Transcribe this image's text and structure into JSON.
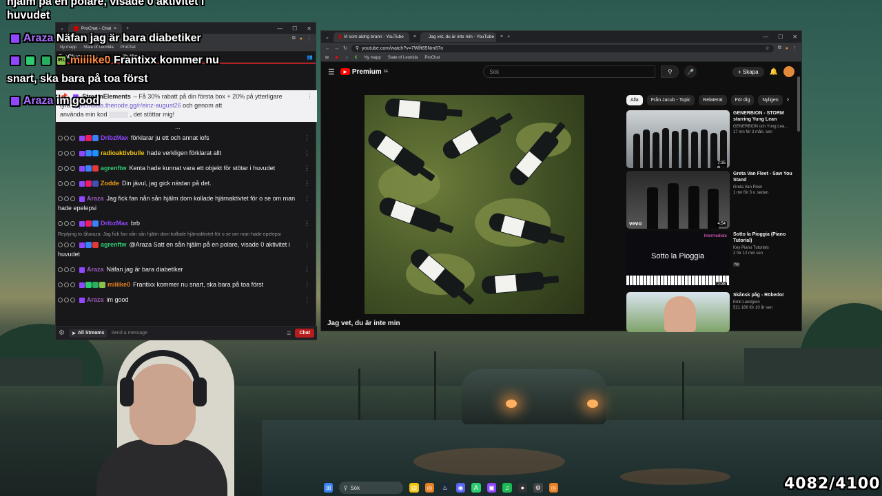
{
  "overlay": {
    "top_line": "hjälm på en polare, visade 0 aktivitet i",
    "top_line2": "huvudet",
    "line1_user": "Araza",
    "line1_text": "Näfan jag är bara diabetiker",
    "line2_user": "miiiike0",
    "line2_text": "Frantixx kommer nu",
    "line2_cont": "snart, ska bara på toa först",
    "line3_user": "Araza",
    "line3_text": "im good",
    "badge_irl": "IRL"
  },
  "chat_window": {
    "tab_title": "ProChat - Chat",
    "bookmarks": [
      "Ny mapp",
      "State of Leonida",
      "ProChat"
    ],
    "header_title": "ProChat",
    "header_badge": "FREE",
    "uptime": "3h 45m",
    "pinned": {
      "author": "StreamElements",
      "text1": "– Få 30% rabatt på din första box + 20% på ytterligare",
      "text2_prefix": "tyra",
      "link": "https://tools.thenode.gg/r/einz-august26",
      "text2_suffix": "och genom att",
      "text3_prefix": "använda min kod",
      "text3_suffix": ", det stöttar mig!"
    },
    "partial_top": "...",
    "messages": [
      {
        "user": "DribzMax",
        "color": "#9146ff",
        "text": "förklarar ju ett och annat iofs",
        "badges": [
          "#9146ff",
          "#e91e63",
          "#3a82f7"
        ]
      },
      {
        "user": "radioaktivbulle",
        "color": "#f1c40f",
        "text": "hade verkligen förklarat allt",
        "badges": [
          "#9146ff",
          "#3a82f7",
          "#1e90ff"
        ]
      },
      {
        "user": "agrenftw",
        "color": "#2ecc71",
        "text": "Kenta hade kunnat vara ett objekt för stötar i huvudet",
        "badges": [
          "#9146ff",
          "#3a82f7",
          "#e53935"
        ]
      },
      {
        "user": "Zodde",
        "color": "#f39c12",
        "text": "Din jävul, jag gick nästan på det.",
        "badges": [
          "#9146ff",
          "#e91e63",
          "#3f51b5"
        ]
      },
      {
        "user": "Araza",
        "color": "#9b59b6",
        "text": "Jag fick fan nån sån hjälm dom kollade hjärnaktivtet för o se om man hade epelepsi",
        "badges": [
          "#9146ff"
        ]
      },
      {
        "user": "DribzMax",
        "color": "#9146ff",
        "text": "brb",
        "badges": [
          "#9146ff",
          "#e91e63",
          "#3a82f7"
        ]
      },
      {
        "reply": "Replying to @araza: Jag fick fan nån sån hjälm dom kollade hjärnaktivtet för o se om man hade epelepsi",
        "user": "agrenftw",
        "color": "#2ecc71",
        "text": "@Araza Satt en sån hjälm på en polare, visade 0 aktivitet i huvudet",
        "badges": [
          "#9146ff",
          "#3a82f7",
          "#e53935"
        ]
      },
      {
        "user": "Araza",
        "color": "#9b59b6",
        "text": "Näfan jag är bara diabetiker",
        "badges": [
          "#9146ff"
        ]
      },
      {
        "user": "miiiike0",
        "color": "#e67e22",
        "text": "Frantixx kommer nu snart, ska bara på toa först",
        "badges": [
          "#9146ff",
          "#2ecc71",
          "#27ae60",
          "#8bc34a"
        ]
      },
      {
        "user": "Araza",
        "color": "#9b59b6",
        "text": "im good",
        "badges": [
          "#9146ff"
        ]
      }
    ],
    "input": {
      "streams_label": "All Streams",
      "placeholder": "Send a message",
      "chat_button": "Chat"
    }
  },
  "youtube_window": {
    "tabs": [
      "Vi som aldrig brann - YouTube",
      "Jag vet, du är inte min - YouTube"
    ],
    "url": "youtube.com/watch?v=7Wlft65Nm87o",
    "bookmarks": [
      "Ny mapp",
      "State of Leonida",
      "ProChat"
    ],
    "logo_text": "Premium",
    "logo_sup": "SE",
    "search_placeholder": "Sök",
    "create_label": "Skapa",
    "video_title": "Jag vet, du är inte min",
    "chips": [
      "Alla",
      "Från Jacub - Topic",
      "Relaterat",
      "För dig",
      "Nyligen"
    ],
    "recommendations": [
      {
        "title": "GENERBION - STORM starring Yung Lean",
        "channel": "GENERBION och Yung Lea...",
        "meta": "17 mn för 3 mån. sen",
        "duration": "7:35"
      },
      {
        "title": "Greta Van Fleet - Saw You Stand",
        "channel": "Greta Van Fleet",
        "meta": "1 mn för 3 v. sedan",
        "duration": "4:54"
      },
      {
        "title": "Sotto la Pioggia (Piano Tutorial)",
        "channel": "Key Piano Tutorials",
        "meta": "2 för 12 min sen",
        "duration": "2:38",
        "badge": "Ny",
        "thumb_text": "Sotto la Pioggia",
        "thumb_tag": "Intermediate"
      },
      {
        "title": "Skånsk påg - Röbedor",
        "channel": "Emil Lundgren",
        "meta": "521 166 för 10 år sen",
        "duration": ""
      }
    ]
  },
  "taskbar": {
    "search_label": "Sök"
  },
  "counter": "4082/4100",
  "colors": {
    "accent_red": "#b91c1c",
    "twitch_purple": "#9146ff",
    "youtube_red": "#ff0000"
  }
}
